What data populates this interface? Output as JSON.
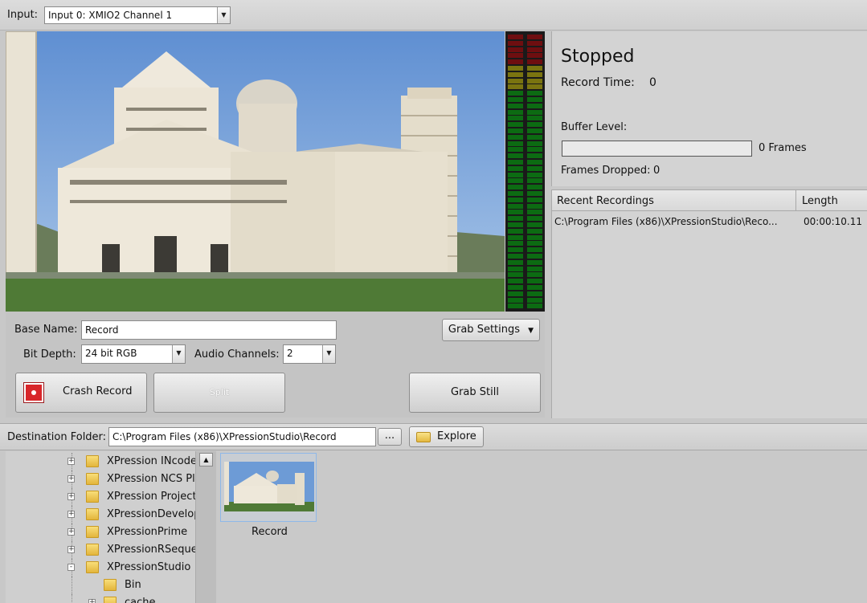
{
  "input": {
    "label": "Input:",
    "selected": "Input 0: XMIO2 Channel 1"
  },
  "controls": {
    "base_name_label": "Base Name:",
    "base_name_value": "Record",
    "grab_settings_label": "Grab Settings",
    "bit_depth_label": "Bit Depth:",
    "bit_depth_value": "24 bit RGB",
    "audio_channels_label": "Audio Channels:",
    "audio_channels_value": "2",
    "crash_record_label": "Crash Record",
    "split_label": "Split",
    "grab_still_label": "Grab Still"
  },
  "status": {
    "state": "Stopped",
    "record_time_label": "Record Time:",
    "record_time_value": "0",
    "buffer_level_label": "Buffer Level:",
    "buffer_level_fraction": 0,
    "buffer_frames_text": "0 Frames",
    "frames_dropped_label": "Frames Dropped:",
    "frames_dropped_value": "0"
  },
  "recent": {
    "columns": [
      "Recent Recordings",
      "Length"
    ],
    "rows": [
      {
        "path": "C:\\Program Files (x86)\\XPressionStudio\\Reco...",
        "length": "00:00:10.11"
      }
    ]
  },
  "destination": {
    "label": "Destination Folder:",
    "path": "C:\\Program Files (x86)\\XPressionStudio\\Record",
    "browse_label": "...",
    "explore_label": "Explore"
  },
  "tree": {
    "items": [
      {
        "label": "XPression INcoder",
        "expand": "+"
      },
      {
        "label": "XPression NCS Plu",
        "expand": "+"
      },
      {
        "label": "XPression Project",
        "expand": "+"
      },
      {
        "label": "XPressionDevelop",
        "expand": "+"
      },
      {
        "label": "XPressionPrime",
        "expand": "+"
      },
      {
        "label": "XPressionRSequer",
        "expand": "+"
      },
      {
        "label": "XPressionStudio",
        "expand": "-"
      },
      {
        "label": "Bin",
        "expand": ""
      },
      {
        "label": "cache",
        "expand": "+"
      }
    ]
  },
  "files": {
    "items": [
      {
        "label": "Record"
      }
    ]
  },
  "colors": {
    "record_red": "#d8262a",
    "meter_green": "#0c6b12",
    "meter_yellow": "#7a7410",
    "meter_red": "#6e0e10",
    "selection_blue": "#8fb8e8"
  },
  "icons": {
    "record": "record-icon",
    "dropdown": "chevron-down-icon",
    "explore": "folder-open-icon",
    "tree_folder": "folder-icon",
    "scroll_up": "scroll-up-icon"
  }
}
